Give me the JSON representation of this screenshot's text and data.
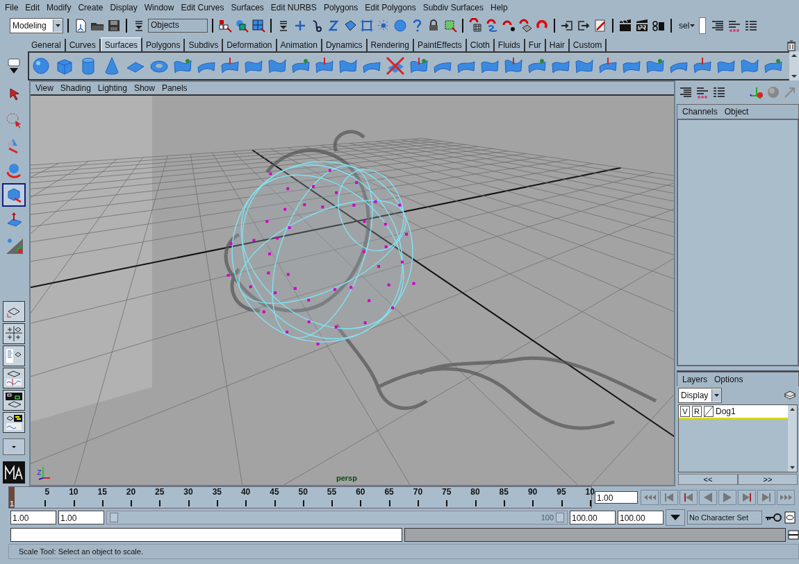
{
  "menu_bar": [
    "File",
    "Edit",
    "Modify",
    "Create",
    "Display",
    "Window",
    "Edit Curves",
    "Surfaces",
    "Edit NURBS",
    "Polygons",
    "Edit Polygons",
    "Subdiv Surfaces",
    "Help"
  ],
  "status_line": {
    "menu_set": "Modeling",
    "selection_field": "Objects",
    "render_selector": "sel"
  },
  "shelf_tabs": [
    {
      "label": "General",
      "selected": false
    },
    {
      "label": "Curves",
      "selected": false
    },
    {
      "label": "Surfaces",
      "selected": true
    },
    {
      "label": "Polygons",
      "selected": false
    },
    {
      "label": "Subdivs",
      "selected": false
    },
    {
      "label": "Deformation",
      "selected": false
    },
    {
      "label": "Animation",
      "selected": false
    },
    {
      "label": "Dynamics",
      "selected": false
    },
    {
      "label": "Rendering",
      "selected": false
    },
    {
      "label": "PaintEffects",
      "selected": false
    },
    {
      "label": "Cloth",
      "selected": false
    },
    {
      "label": "Fluids",
      "selected": false
    },
    {
      "label": "Fur",
      "selected": false
    },
    {
      "label": "Hair",
      "selected": false
    },
    {
      "label": "Custom",
      "selected": false
    }
  ],
  "toolbox": [
    {
      "selected": false
    },
    {
      "selected": false
    },
    {
      "selected": false
    },
    {
      "selected": false
    },
    {
      "selected": true
    },
    {
      "selected": false
    },
    {
      "selected": false
    }
  ],
  "viewport": {
    "menu": [
      "View",
      "Shading",
      "Lighting",
      "Show",
      "Panels"
    ],
    "camera_label": "persp"
  },
  "channel_box": {
    "menu": [
      "Channels",
      "Object"
    ]
  },
  "layer_editor": {
    "menu": [
      "Layers",
      "Options"
    ],
    "mode": "Display",
    "layers": [
      {
        "visibility": "V",
        "render": "R",
        "name": "Dog1"
      }
    ],
    "nav": [
      "<<",
      ">>"
    ]
  },
  "time_slider": {
    "level": 0,
    "current_frame": "1",
    "ticks": [
      "5",
      "10",
      "15",
      "20",
      "25",
      "30",
      "35",
      "40",
      "45",
      "50",
      "55",
      "60",
      "65",
      "70",
      "75",
      "80",
      "85",
      "90",
      "95",
      "10"
    ],
    "current_time": "1.00"
  },
  "range_slider": {
    "level": 1,
    "start_time": "1.00",
    "range_start": "1.00",
    "range_end_label": "100",
    "range_end": "100.00",
    "end_time": "100.00",
    "character_set": "No Character Set"
  },
  "help_line": "Scale Tool: Select an object to scale."
}
